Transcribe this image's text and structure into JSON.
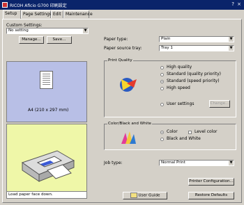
{
  "window": {
    "title": "RICOH Aficio G700 印刷設定",
    "controls": "? ×"
  },
  "tabs": [
    "Setup",
    "Page Settings",
    "Edit",
    "Maintenance"
  ],
  "custom_settings": {
    "label": "Custom Settings:",
    "value": "No setting",
    "manage": "Manage...",
    "save": "Save..."
  },
  "preview": {
    "paper_label": "A4 (210 x 297 mm)",
    "status": "Load paper face down."
  },
  "paper": {
    "type_label": "Paper type:",
    "type_value": "Plain",
    "source_label": "Paper source tray:",
    "source_value": "Tray 1"
  },
  "print_quality": {
    "legend": "Print Quality",
    "options": [
      "High quality",
      "Standard (quality priority)",
      "Standard (speed priority)",
      "High speed"
    ],
    "selected_index": 2,
    "user_settings": "User settings",
    "change": "Change..."
  },
  "color": {
    "legend": "Color/Black and White",
    "color": "Color",
    "level_color": "Level color",
    "bw": "Black and White"
  },
  "job": {
    "label": "Job type:",
    "value": "Normal Print"
  },
  "buttons": {
    "printer_config": "Printer Configuration...",
    "user_guide": "User Guide",
    "restore": "Restore Defaults"
  }
}
